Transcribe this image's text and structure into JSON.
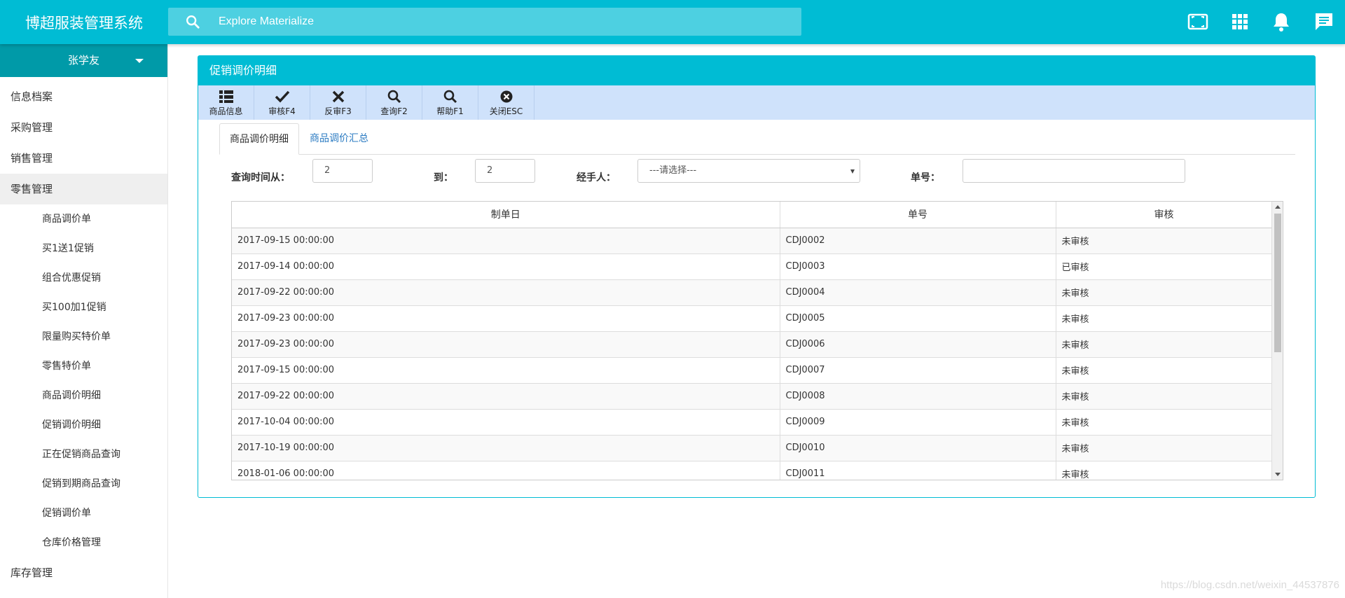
{
  "app": {
    "title": "博超服装管理系统"
  },
  "search": {
    "placeholder": "Explore Materialize"
  },
  "topbar_icons": [
    "fullscreen-icon",
    "apps-icon",
    "notifications-icon",
    "chat-icon"
  ],
  "user": {
    "name": "张学友"
  },
  "sidebar": {
    "items": [
      {
        "label": "信息档案"
      },
      {
        "label": "采购管理"
      },
      {
        "label": "销售管理"
      },
      {
        "label": "零售管理",
        "active": true
      },
      {
        "label": "库存管理"
      }
    ],
    "subitems": [
      "商品调价单",
      "买1送1促销",
      "组合优惠促销",
      "买100加1促销",
      "限量购买特价单",
      "零售特价单",
      "商品调价明细",
      "促销调价明细",
      "正在促销商品查询",
      "促销到期商品查询",
      "促销调价单",
      "仓库价格管理"
    ]
  },
  "panel": {
    "title": "促销调价明细"
  },
  "toolbar": [
    {
      "label": "商品信息",
      "icon": "list-icon"
    },
    {
      "label": "审核F4",
      "icon": "check-icon"
    },
    {
      "label": "反审F3",
      "icon": "close-icon"
    },
    {
      "label": "查询F2",
      "icon": "search-icon"
    },
    {
      "label": "帮助F1",
      "icon": "search-icon"
    },
    {
      "label": "关闭ESC",
      "icon": "close-circle-icon"
    }
  ],
  "tabs": [
    {
      "label": "商品调价明细",
      "active": true
    },
    {
      "label": "商品调价汇总",
      "active": false
    }
  ],
  "filters": {
    "from_label": "查询时间从：",
    "from_value": "2",
    "to_label": "到：",
    "to_value": "2",
    "handler_label": "经手人：",
    "handler_value": "---请选择---",
    "number_label": "单号：",
    "number_value": ""
  },
  "table": {
    "columns": [
      "制单日",
      "单号",
      "审核"
    ],
    "rows": [
      [
        "2017-09-15 00:00:00",
        "CDJ0002",
        "未审核"
      ],
      [
        "2017-09-14 00:00:00",
        "CDJ0003",
        "已审核"
      ],
      [
        "2017-09-22 00:00:00",
        "CDJ0004",
        "未审核"
      ],
      [
        "2017-09-23 00:00:00",
        "CDJ0005",
        "未审核"
      ],
      [
        "2017-09-23 00:00:00",
        "CDJ0006",
        "未审核"
      ],
      [
        "2017-09-15 00:00:00",
        "CDJ0007",
        "未审核"
      ],
      [
        "2017-09-22 00:00:00",
        "CDJ0008",
        "未审核"
      ],
      [
        "2017-10-04 00:00:00",
        "CDJ0009",
        "未审核"
      ],
      [
        "2017-10-19 00:00:00",
        "CDJ0010",
        "未审核"
      ],
      [
        "2018-01-06 00:00:00",
        "CDJ0011",
        "未审核"
      ]
    ]
  },
  "watermark": "https://blog.csdn.net/weixin_44537876",
  "colors": {
    "primary": "#00bcd4",
    "toolbar": "#cfe2fb",
    "link": "#2b7bc2"
  }
}
